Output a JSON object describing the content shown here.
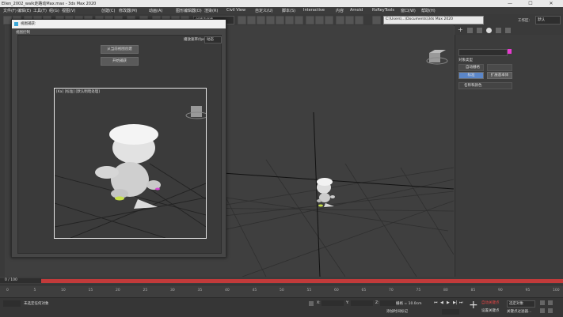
{
  "window": {
    "title": "Ellen_2002_walk走路动Max.max - 3ds Max 2020",
    "controls": [
      "—",
      "☐",
      "✕"
    ]
  },
  "menus": [
    "文件(F)",
    "编辑(E)",
    "工具(T)",
    "组(G)",
    "视图(V)",
    "创建(C)",
    "修改器(M)",
    "动画(A)",
    "图形编辑器(D)",
    "渲染(R)",
    "Civil View",
    "自定义(U)",
    "脚本(S)",
    "Interactive",
    "内容",
    "Arnold",
    "RxReyTools",
    "窗口(W)",
    "帮助(H)"
  ],
  "toolbar": {
    "selection_set": "创建选择集",
    "path": "C:\\Users\\...\\Documents\\3ds Max 2020",
    "workspace": "工作区:",
    "workspace_value": "默认"
  },
  "viewport": {
    "label": "[+] [透视] [标准] [默认明暗处理]"
  },
  "dialog": {
    "title": "视图捕获:",
    "section": "视图控制",
    "fps_label": "播放速率(fps):",
    "fps_value": "动态",
    "buttons": {
      "create_preview": "从当前视图创建",
      "start_capture": "开始捕获"
    },
    "preview_label": "[Ka] [标准] [默认明暗处理]"
  },
  "command_panel": {
    "label_obj": "对象类型",
    "label_autogrid": "自动栅格",
    "btn_standard": "标准",
    "btn_extended": "扩展基本体",
    "rollout": "名称和颜色"
  },
  "timeline": {
    "range": "0 / 100",
    "ticks": [
      "0",
      "5",
      "10",
      "15",
      "20",
      "25",
      "30",
      "35",
      "40",
      "45",
      "50",
      "55",
      "60",
      "65",
      "70",
      "75",
      "80",
      "85",
      "90",
      "95",
      "100"
    ]
  },
  "status": {
    "left_text": "未选定任何对象",
    "x_label": "X:",
    "y_label": "Y:",
    "z_label": "Z:",
    "grid": "栅格 = 10.0cm",
    "add_key": "添加时间标记",
    "autokey": "自动关键点",
    "setkey": "设置关键点",
    "selected": "选定对象",
    "key_filter": "关键点过滤器..."
  },
  "colors": {
    "accent_blue": "#5b86c8",
    "magenta": "#e83ad0",
    "red": "#c23a3a"
  }
}
